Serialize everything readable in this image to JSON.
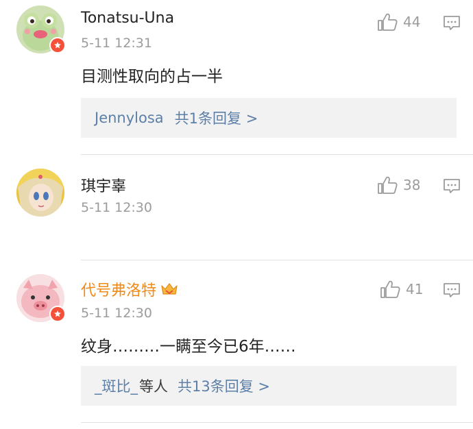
{
  "comments": [
    {
      "username": "Tonatsu-Una",
      "time": "5-11 12:31",
      "likes": "44",
      "text": "目测性取向的占一半",
      "replies": {
        "who": "Jennylosa",
        "mid": "",
        "count": "共1条回复 >"
      }
    },
    {
      "username": "琪宇辜",
      "time": "5-11 12:30",
      "likes": "38"
    },
    {
      "username": "代号弗洛特",
      "time": "5-11 12:30",
      "likes": "41",
      "text": "纹身………一瞒至今已6年……",
      "replies": {
        "who": "_斑比_",
        "mid": "等人",
        "count": "共13条回复 >"
      }
    }
  ],
  "colors": {
    "link": "#5c7fa8",
    "vip_name": "#f08a18",
    "verified_badge": "#f4503a",
    "meta_gray": "#9b9b9b"
  },
  "icons": [
    "thumbs-up-icon",
    "comment-reply-icon",
    "verified-badge-icon",
    "crown-icon"
  ]
}
